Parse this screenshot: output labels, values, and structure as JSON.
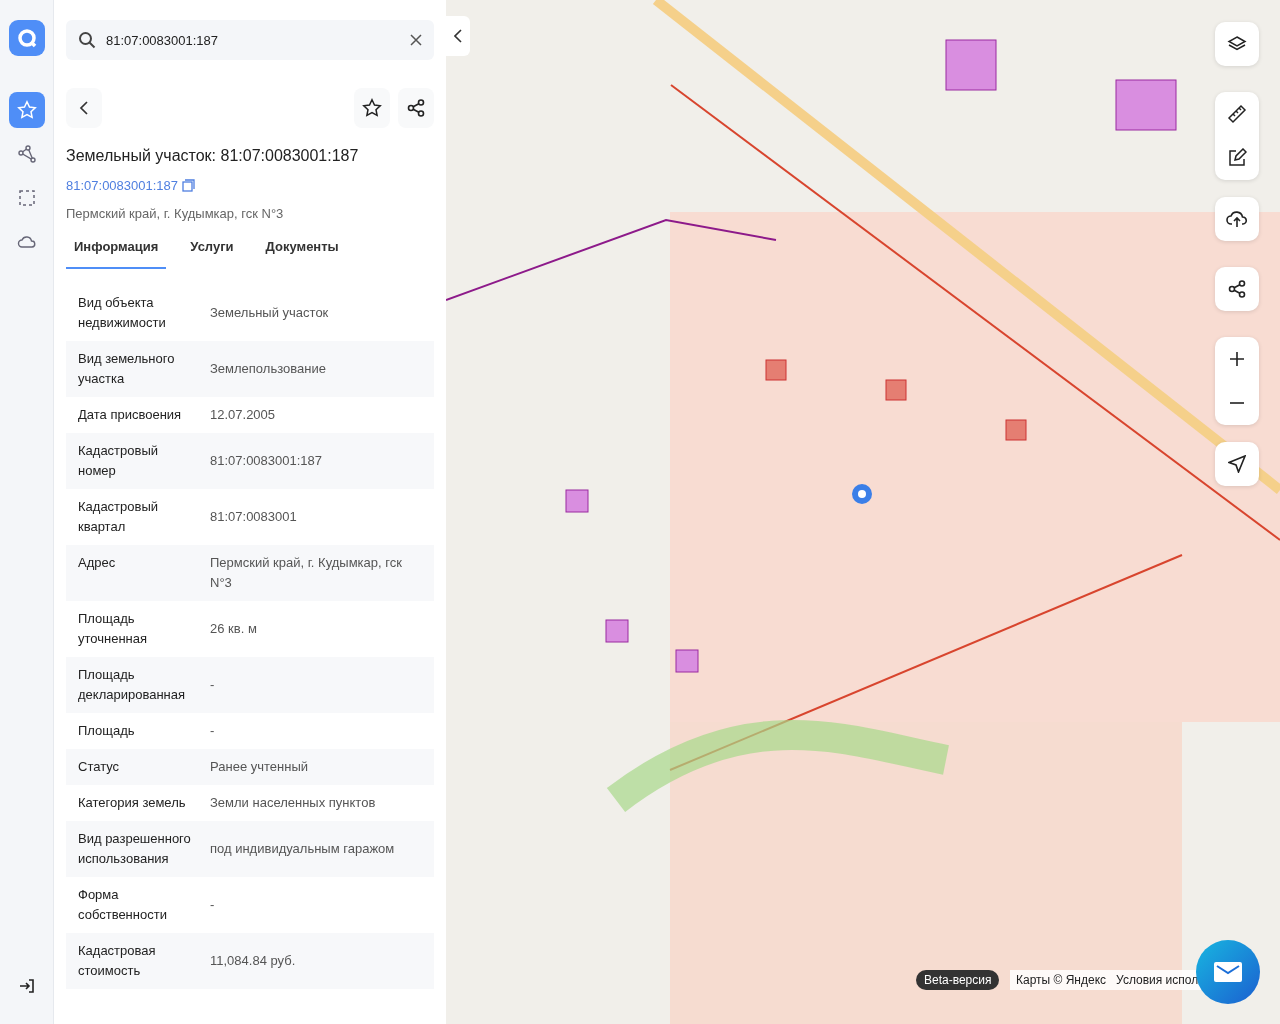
{
  "search": {
    "value": "81:07:0083001:187"
  },
  "rail": [
    {
      "kind": "favorites",
      "selected": true
    },
    {
      "kind": "polygon",
      "selected": false
    },
    {
      "kind": "selection",
      "selected": false
    },
    {
      "kind": "cloud",
      "selected": false
    }
  ],
  "object": {
    "title": "Земельный участок: 81:07:0083001:187",
    "number_link": "81:07:0083001:187",
    "address": "Пермский край, г. Кудымкар, гск N°3"
  },
  "tabs": [
    {
      "label": "Информация",
      "selected": true
    },
    {
      "label": "Услуги",
      "selected": false
    },
    {
      "label": "Документы",
      "selected": false
    }
  ],
  "properties": [
    {
      "label": "Вид объекта недвижимости",
      "value": "Земельный участок"
    },
    {
      "label": "Вид земельного участка",
      "value": "Землепользование"
    },
    {
      "label": "Дата присвоения",
      "value": "12.07.2005"
    },
    {
      "label": "Кадастровый номер",
      "value": "81:07:0083001:187"
    },
    {
      "label": "Кадастровый квартал",
      "value": "81:07:0083001"
    },
    {
      "label": "Адрес",
      "value": "Пермский край, г. Кудымкар, гск N°3"
    },
    {
      "label": "Площадь уточненная",
      "value": "26 кв. м"
    },
    {
      "label": "Площадь декларированная",
      "value": "-"
    },
    {
      "label": "Площадь",
      "value": "-"
    },
    {
      "label": "Статус",
      "value": "Ранее учтенный"
    },
    {
      "label": "Категория земель",
      "value": "Земли населенных пунктов"
    },
    {
      "label": "Вид разрешенного использования",
      "value": "под индивидуальным гаражом"
    },
    {
      "label": "Форма собственности",
      "value": "-"
    },
    {
      "label": "Кадастровая стоимость",
      "value": "11,084.84 руб."
    }
  ],
  "map": {
    "badge": "Beta-версия",
    "attribution": "Карты © Яндекс",
    "terms_link": "Условия испол"
  }
}
